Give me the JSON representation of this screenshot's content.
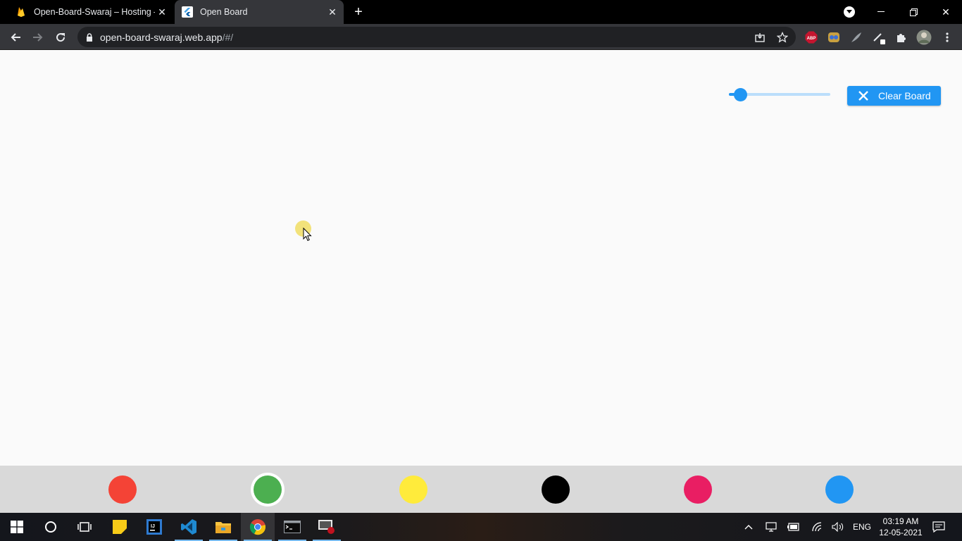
{
  "browser": {
    "tabs": [
      {
        "title": "Open-Board-Swaraj – Hosting – F",
        "favicon": "firebase-icon"
      },
      {
        "title": "Open Board",
        "favicon": "flutter-icon",
        "active": true
      }
    ],
    "url_host": "open-board-swaraj.web.app",
    "url_path": "/#/",
    "extensions": [
      "ABP",
      "tampermonkey-icon",
      "quill-icon",
      "pen-icon",
      "puzzle-icon",
      "avatar",
      "kebab-menu-icon"
    ]
  },
  "app": {
    "clear_button_label": "Clear Board",
    "stroke_width_slider": {
      "value_fraction": 0.12
    },
    "palette": [
      {
        "name": "red",
        "color": "#f44336"
      },
      {
        "name": "green",
        "color": "#4caf50",
        "selected": true
      },
      {
        "name": "yellow",
        "color": "#ffeb3b"
      },
      {
        "name": "black",
        "color": "#000000"
      },
      {
        "name": "pink",
        "color": "#e91e63"
      },
      {
        "name": "blue",
        "color": "#2196f3"
      }
    ]
  },
  "taskbar": {
    "apps": [
      "start-icon",
      "cortana-icon",
      "task-view-icon",
      "sticky-notes-icon",
      "intellij-icon",
      "vscode-icon",
      "file-explorer-icon",
      "chrome-icon",
      "terminal-icon",
      "screen-recorder-icon"
    ],
    "language": "ENG",
    "time": "03:19 AM",
    "date": "12-05-2021"
  }
}
